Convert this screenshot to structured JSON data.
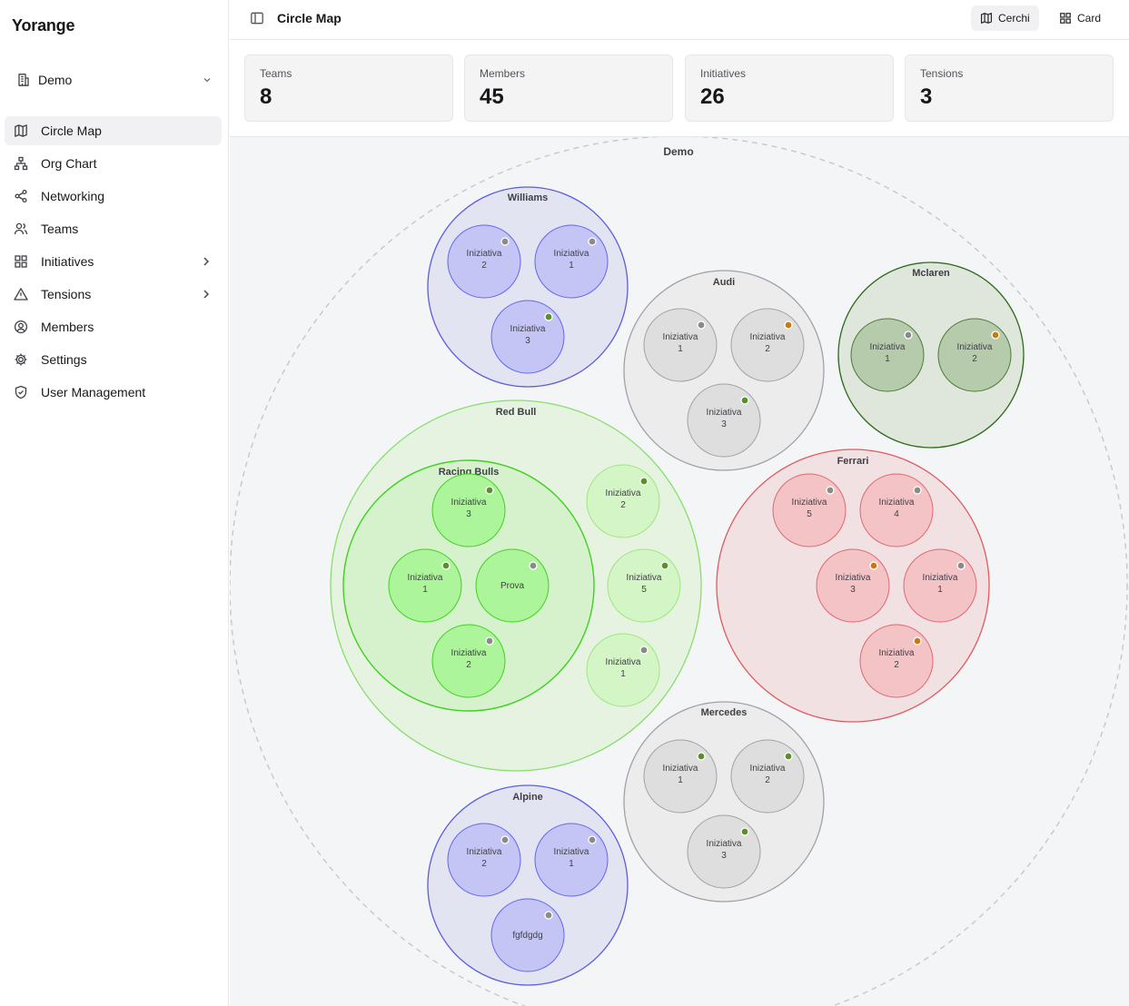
{
  "app": {
    "brand": "Yorange"
  },
  "org": {
    "name": "Demo"
  },
  "nav": {
    "items": [
      {
        "label": "Circle Map",
        "icon": "map-icon",
        "active": true
      },
      {
        "label": "Org Chart",
        "icon": "org-chart-icon"
      },
      {
        "label": "Networking",
        "icon": "share-icon"
      },
      {
        "label": "Teams",
        "icon": "users-icon"
      },
      {
        "label": "Initiatives",
        "icon": "grid-icon",
        "expandable": true
      },
      {
        "label": "Tensions",
        "icon": "warning-icon",
        "expandable": true
      },
      {
        "label": "Members",
        "icon": "user-circle-icon"
      },
      {
        "label": "Settings",
        "icon": "gear-icon"
      },
      {
        "label": "User Management",
        "icon": "shield-icon"
      }
    ]
  },
  "header": {
    "title": "Circle Map",
    "views": [
      {
        "label": "Cerchi",
        "icon": "map-icon",
        "active": true
      },
      {
        "label": "Card",
        "icon": "grid-icon",
        "active": false
      }
    ]
  },
  "stats": [
    {
      "label": "Teams",
      "value": "8"
    },
    {
      "label": "Members",
      "value": "45"
    },
    {
      "label": "Initiatives",
      "value": "26"
    },
    {
      "label": "Tensions",
      "value": "3"
    }
  ],
  "colors": {
    "blue": {
      "fill": "#e3e4f2",
      "stroke": "#5b5ce0",
      "inner": "#c4c5f5",
      "innerStroke": "#6366f1"
    },
    "gray": {
      "fill": "#ececec",
      "stroke": "#a1a1aa",
      "inner": "#dedede",
      "innerStroke": "#a1a1aa"
    },
    "darkgreen": {
      "fill": "#dfe6dc",
      "stroke": "#2f6b1a",
      "inner": "#b6cbab",
      "innerStroke": "#4d7c35"
    },
    "lightgreen": {
      "fill": "#e6f3e1",
      "stroke": "#86e06a",
      "inner": "#d4f5c6",
      "innerStroke": "#9be87d"
    },
    "green": {
      "fill": "#d6f2cc",
      "stroke": "#3fd21f",
      "inner": "#adf59a",
      "innerStroke": "#3fd21f"
    },
    "red": {
      "fill": "#f1e1e2",
      "stroke": "#e05a60",
      "inner": "#f3c3c6",
      "innerStroke": "#e06870"
    },
    "dots": {
      "gray": "#8a8a8a",
      "green": "#5a8f2a",
      "orange": "#c87a12"
    }
  },
  "circle_map": {
    "root": "Demo",
    "teams": [
      {
        "name": "Williams",
        "color": "blue",
        "initiatives": [
          {
            "label": "Iniziativa 2",
            "status": "gray"
          },
          {
            "label": "Iniziativa 1",
            "status": "gray"
          },
          {
            "label": "Iniziativa 3",
            "status": "green"
          }
        ]
      },
      {
        "name": "Audi",
        "color": "gray",
        "initiatives": [
          {
            "label": "Iniziativa 1",
            "status": "gray"
          },
          {
            "label": "Iniziativa 2",
            "status": "orange"
          },
          {
            "label": "Iniziativa 3",
            "status": "green"
          }
        ]
      },
      {
        "name": "Mclaren",
        "color": "darkgreen",
        "initiatives": [
          {
            "label": "Iniziativa 1",
            "status": "gray"
          },
          {
            "label": "Iniziativa 2",
            "status": "orange"
          }
        ]
      },
      {
        "name": "Red Bull",
        "color": "lightgreen",
        "initiatives": [
          {
            "label": "Iniziativa 2",
            "status": "green"
          },
          {
            "label": "Iniziativa 5",
            "status": "green"
          },
          {
            "label": "Iniziativa 1",
            "status": "gray"
          }
        ],
        "subteam": {
          "name": "Racing Bulls",
          "color": "green",
          "initiatives": [
            {
              "label": "Iniziativa 3",
              "status": "green"
            },
            {
              "label": "Iniziativa 1",
              "status": "green"
            },
            {
              "label": "Prova",
              "status": "gray"
            },
            {
              "label": "Iniziativa 2",
              "status": "gray"
            }
          ]
        }
      },
      {
        "name": "Ferrari",
        "color": "red",
        "initiatives": [
          {
            "label": "Iniziativa 5",
            "status": "gray"
          },
          {
            "label": "Iniziativa 4",
            "status": "gray"
          },
          {
            "label": "Iniziativa 3",
            "status": "orange"
          },
          {
            "label": "Iniziativa 1",
            "status": "gray"
          },
          {
            "label": "Iniziativa 2",
            "status": "orange"
          }
        ]
      },
      {
        "name": "Mercedes",
        "color": "gray",
        "initiatives": [
          {
            "label": "Iniziativa 1",
            "status": "green"
          },
          {
            "label": "Iniziativa 2",
            "status": "green"
          },
          {
            "label": "Iniziativa 3",
            "status": "green"
          }
        ]
      },
      {
        "name": "Alpine",
        "color": "blue",
        "initiatives": [
          {
            "label": "Iniziativa 2",
            "status": "gray"
          },
          {
            "label": "Iniziativa 1",
            "status": "gray"
          },
          {
            "label": "fgfdgdg",
            "status": "gray"
          }
        ]
      }
    ]
  }
}
